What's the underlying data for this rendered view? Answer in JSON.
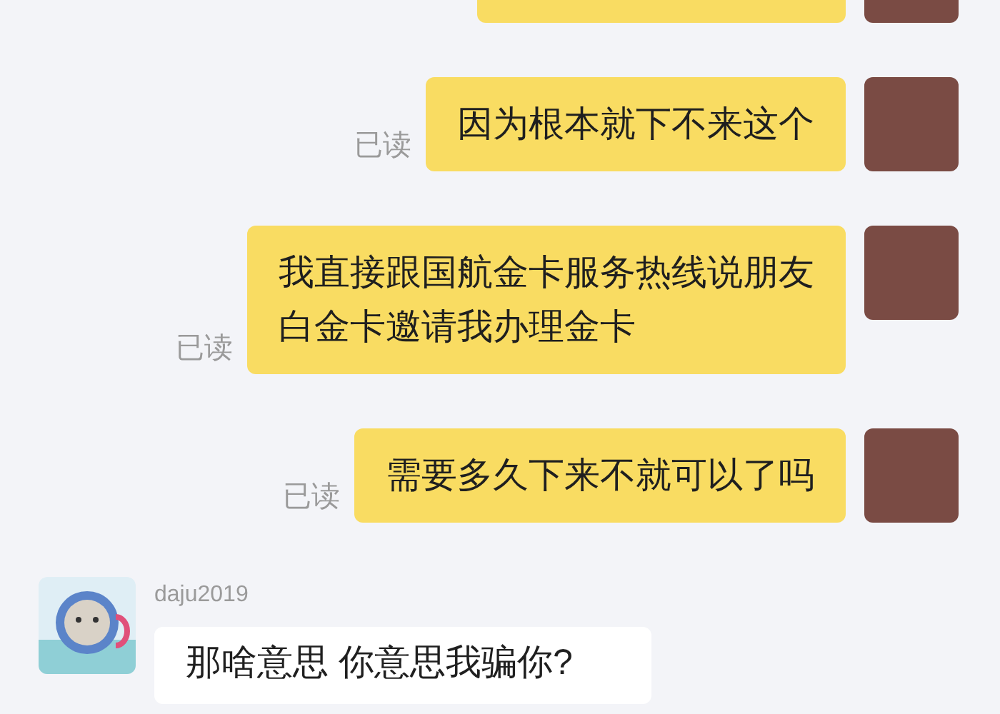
{
  "messages": [
    {
      "kind": "outgoing"
    },
    {
      "kind": "outgoing",
      "read_label": "已读",
      "lines": [
        "因为根本就下不来这个"
      ]
    },
    {
      "kind": "outgoing",
      "read_label": "已读",
      "lines": [
        "我直接跟国航金卡服务热线说朋友",
        "白金卡邀请我办理金卡"
      ]
    },
    {
      "kind": "outgoing",
      "read_label": "已读",
      "lines": [
        "需要多久下来不就可以了吗"
      ]
    },
    {
      "kind": "incoming",
      "sender": "daju2019",
      "lines": [
        "那啥意思 你意思我骗你?"
      ]
    }
  ]
}
